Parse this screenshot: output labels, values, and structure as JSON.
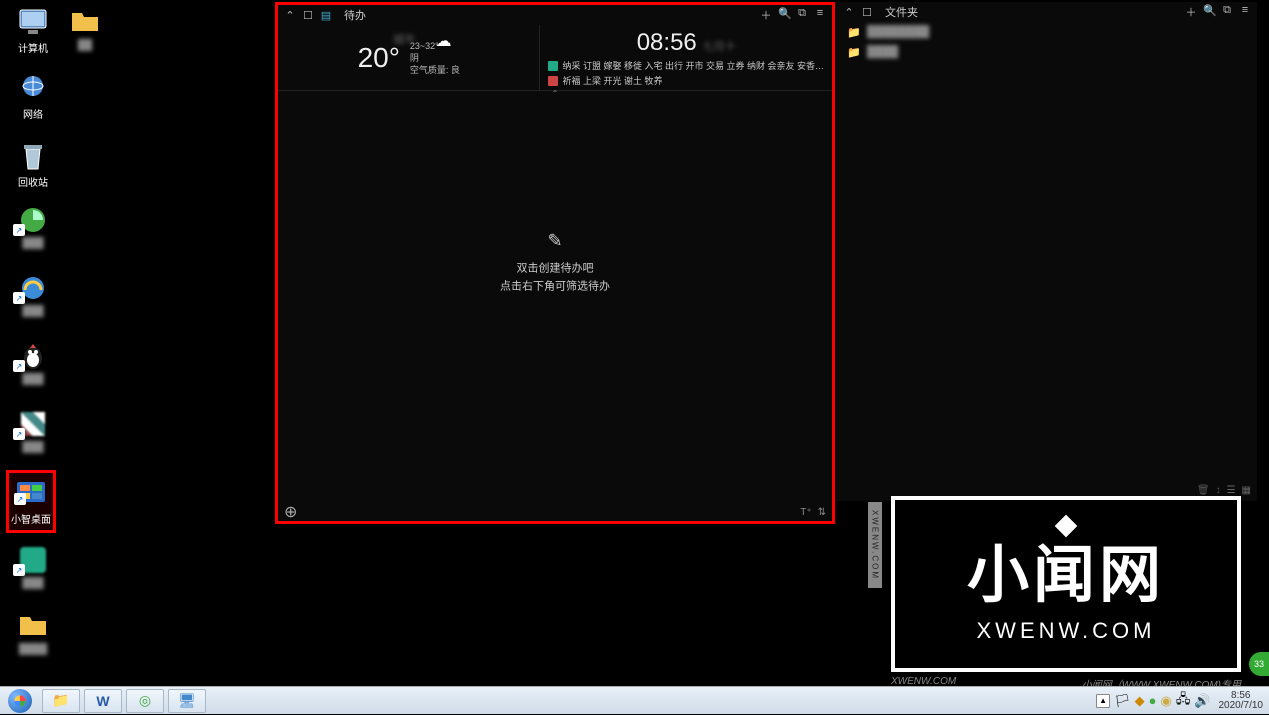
{
  "desktop": {
    "icons": [
      {
        "label": "计算机"
      },
      {
        "label": ""
      },
      {
        "label": "网络"
      },
      {
        "label": "回收站"
      },
      {
        "label": ""
      },
      {
        "label": ""
      },
      {
        "label": ""
      },
      {
        "label": ""
      },
      {
        "label": "小智桌面"
      },
      {
        "label": ""
      },
      {
        "label": ""
      }
    ]
  },
  "todo_widget": {
    "title": "待办",
    "weather": {
      "city": "城市",
      "temp": "20°",
      "range": "23~32°",
      "cond": "阴",
      "aqi": "空气质量: 良"
    },
    "clock": {
      "time": "08:56",
      "date": "七月十"
    },
    "news": [
      "纳采 订盟 嫁娶 移徙 入宅 出行 开市 交易 立券 纳财 会亲友 安香…",
      "祈福 上梁 开光 谢土 牧养"
    ],
    "empty": {
      "line1": "双击创建待办吧",
      "line2": "点击右下角可筛选待办"
    }
  },
  "folder_widget": {
    "title": "文件夹",
    "items": [
      {
        "name": "████████"
      },
      {
        "name": "████"
      }
    ]
  },
  "watermark": {
    "big": "小闻网",
    "sub": "XWENW.COM",
    "footer_left": "XWENW.COM",
    "footer_right": "小闻网（WWW.XWENW.COM)专用"
  },
  "taskbar": {
    "clock": {
      "time": "8:56",
      "date": "2020/7/10"
    }
  },
  "badge": "33"
}
